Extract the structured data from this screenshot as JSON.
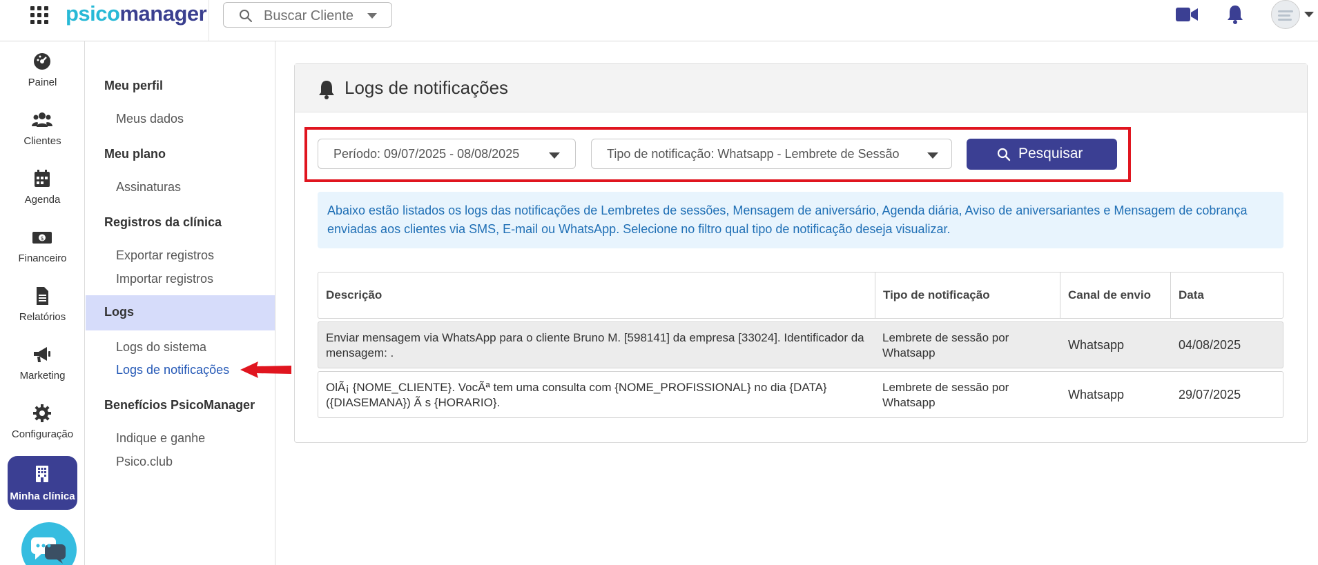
{
  "topbar": {
    "logo_part1": "psico",
    "logo_part2": "manager",
    "search_placeholder": "Buscar Cliente"
  },
  "rail": {
    "items": [
      {
        "label": "Painel",
        "icon": "dashboard-icon"
      },
      {
        "label": "Clientes",
        "icon": "users-icon"
      },
      {
        "label": "Agenda",
        "icon": "calendar-icon"
      },
      {
        "label": "Financeiro",
        "icon": "money-icon"
      },
      {
        "label": "Relatórios",
        "icon": "report-icon"
      },
      {
        "label": "Marketing",
        "icon": "megaphone-icon"
      },
      {
        "label": "Configuração",
        "icon": "gear-icon"
      }
    ],
    "active": {
      "label": "Minha clínica",
      "icon": "building-icon"
    }
  },
  "submenu": {
    "my_profile": "Meu perfil",
    "my_data": "Meus dados",
    "my_plan": "Meu plano",
    "subscriptions": "Assinaturas",
    "clinic_records": "Registros da clínica",
    "export_records": "Exportar registros",
    "import_records": "Importar registros",
    "logs": "Logs",
    "system_logs": "Logs do sistema",
    "notification_logs": "Logs de notificações",
    "benefits": "Benefícios PsicoManager",
    "refer_earn": "Indique e ganhe",
    "psico_club": "Psico.club"
  },
  "panel": {
    "title": "Logs de notificações",
    "period_filter": "Período: 09/07/2025 - 08/08/2025",
    "type_filter": "Tipo de notificação: Whatsapp - Lembrete de Sessão",
    "search_button": "Pesquisar",
    "info_text": "Abaixo estão listados os logs das notificações de Lembretes de sessões, Mensagem de aniversário, Agenda diária, Aviso de aniversariantes e Mensagem de cobrança enviadas aos clientes via SMS, E-mail ou WhatsApp. Selecione no filtro qual tipo de notificação deseja visualizar."
  },
  "table": {
    "headers": [
      "Descrição",
      "Tipo de notificação",
      "Canal de envio",
      "Data"
    ],
    "rows": [
      {
        "description": "Enviar mensagem via WhatsApp para o cliente Bruno M. [598141] da empresa [33024]. Identificador da mensagem: .",
        "type": "Lembrete de sessão por Whatsapp",
        "channel": "Whatsapp",
        "date": "04/08/2025"
      },
      {
        "description": "OlÃ¡ {NOME_CLIENTE}. VocÃª tem uma consulta com {NOME_PROFISSIONAL} no dia {DATA} ({DIASEMANA}) Ã s {HORARIO}.",
        "type": "Lembrete de sessão por Whatsapp",
        "channel": "Whatsapp",
        "date": "29/07/2025"
      }
    ]
  },
  "colors": {
    "brand_dark": "#3b3f93",
    "brand_light": "#28b9d6",
    "highlight_red": "#e0151f",
    "info_bg": "#e8f4fd",
    "submenu_active_bg": "#d6dcfa"
  }
}
